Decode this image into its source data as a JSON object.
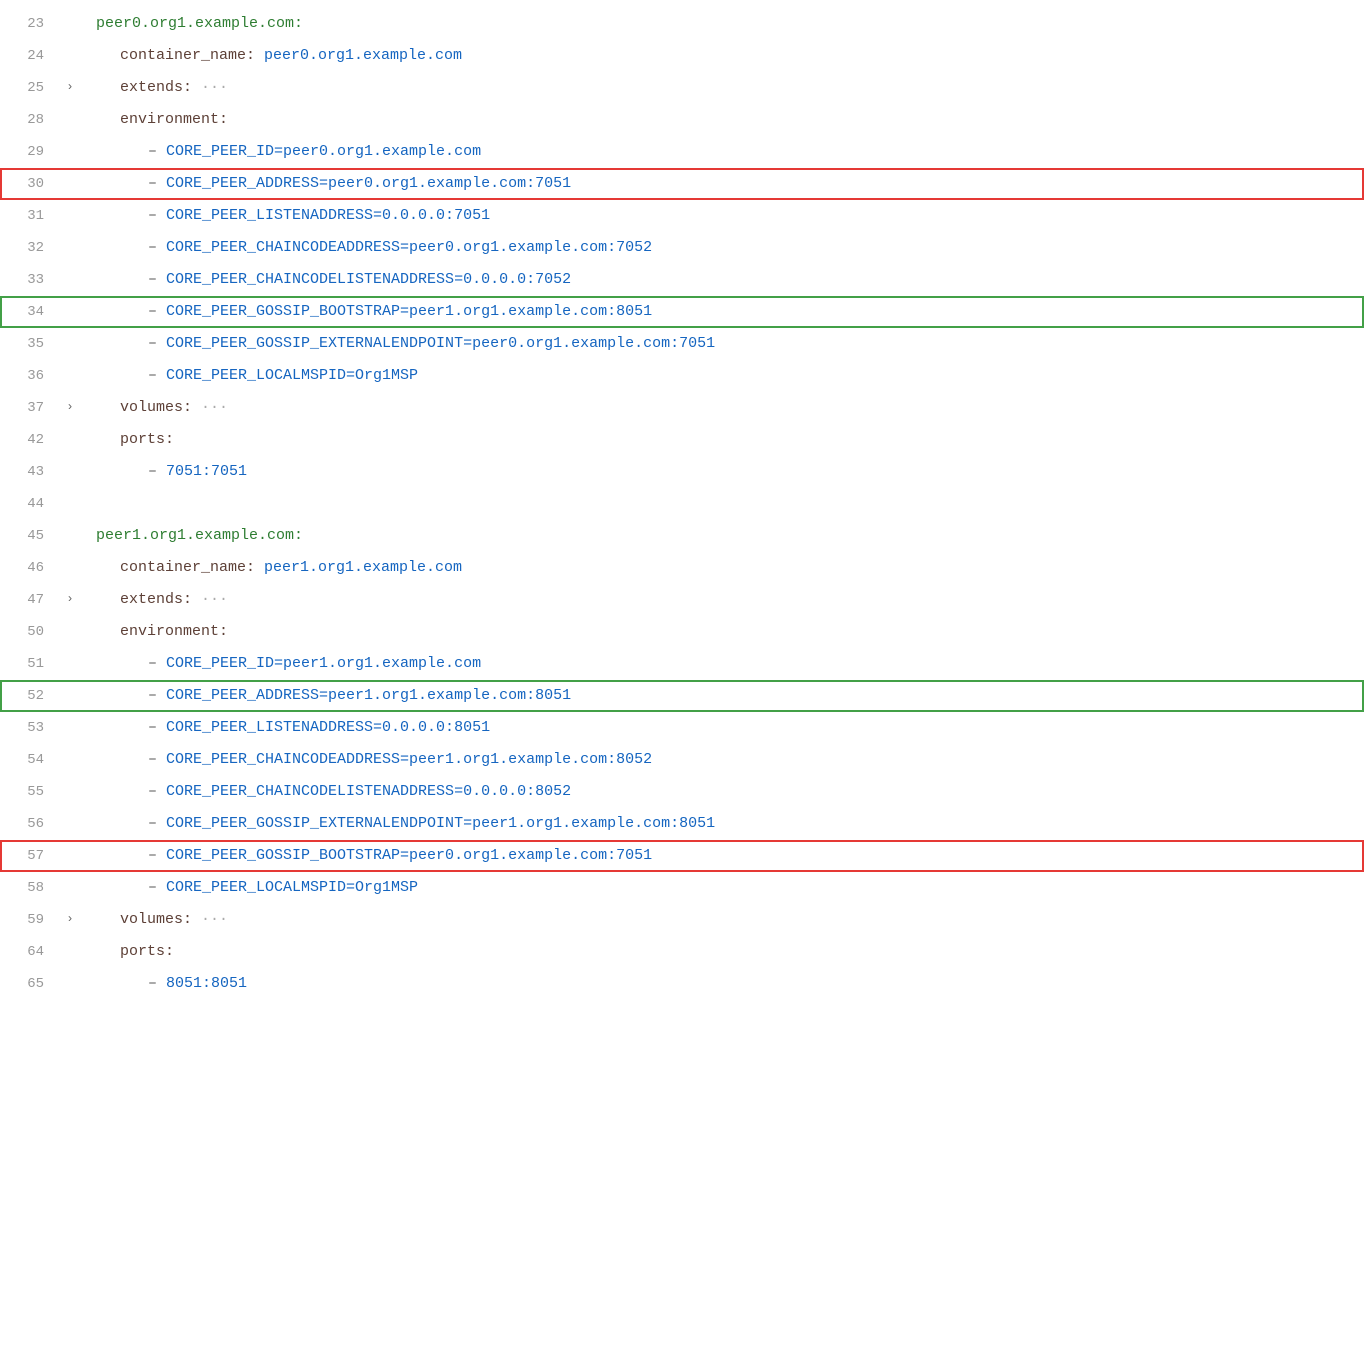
{
  "lines": [
    {
      "num": 23,
      "indent": 1,
      "highlight": null,
      "gutter": null,
      "content": [
        {
          "type": "key-green",
          "text": "peer0.org1.example.com:"
        }
      ]
    },
    {
      "num": 24,
      "indent": 2,
      "highlight": null,
      "gutter": null,
      "content": [
        {
          "type": "key-dark",
          "text": "container_name: "
        },
        {
          "type": "value-blue",
          "text": "peer0.org1.example.com"
        }
      ]
    },
    {
      "num": 25,
      "indent": 2,
      "highlight": null,
      "gutter": "›",
      "content": [
        {
          "type": "key-dark",
          "text": "extends: "
        },
        {
          "type": "ellipsis",
          "text": "···"
        }
      ]
    },
    {
      "num": 28,
      "indent": 2,
      "highlight": null,
      "gutter": null,
      "content": [
        {
          "type": "key-dark",
          "text": "environment:"
        }
      ]
    },
    {
      "num": 29,
      "indent": 3,
      "highlight": null,
      "gutter": null,
      "content": [
        {
          "type": "dash",
          "text": "– "
        },
        {
          "type": "value-blue",
          "text": "CORE_PEER_ID=peer0.org1.example.com"
        }
      ]
    },
    {
      "num": 30,
      "indent": 3,
      "highlight": "red",
      "gutter": null,
      "content": [
        {
          "type": "dash",
          "text": "– "
        },
        {
          "type": "value-blue",
          "text": "CORE_PEER_ADDRESS=peer0.org1.example.com:7051"
        }
      ]
    },
    {
      "num": 31,
      "indent": 3,
      "highlight": null,
      "gutter": null,
      "content": [
        {
          "type": "dash",
          "text": "– "
        },
        {
          "type": "value-blue",
          "text": "CORE_PEER_LISTENADDRESS=0.0.0.0:7051"
        }
      ]
    },
    {
      "num": 32,
      "indent": 3,
      "highlight": null,
      "gutter": null,
      "content": [
        {
          "type": "dash",
          "text": "– "
        },
        {
          "type": "value-blue",
          "text": "CORE_PEER_CHAINCODEADDRESS=peer0.org1.example.com:7052"
        }
      ]
    },
    {
      "num": 33,
      "indent": 3,
      "highlight": null,
      "gutter": null,
      "content": [
        {
          "type": "dash",
          "text": "– "
        },
        {
          "type": "value-blue",
          "text": "CORE_PEER_CHAINCODELISTENADDRESS=0.0.0.0:7052"
        }
      ]
    },
    {
      "num": 34,
      "indent": 3,
      "highlight": "green",
      "gutter": null,
      "content": [
        {
          "type": "dash",
          "text": "– "
        },
        {
          "type": "value-blue",
          "text": "CORE_PEER_GOSSIP_BOOTSTRAP=peer1.org1.example.com:8051"
        }
      ]
    },
    {
      "num": 35,
      "indent": 3,
      "highlight": null,
      "gutter": null,
      "content": [
        {
          "type": "dash",
          "text": "– "
        },
        {
          "type": "value-blue",
          "text": "CORE_PEER_GOSSIP_EXTERNALENDPOINT=peer0.org1.example.com:7051"
        }
      ]
    },
    {
      "num": 36,
      "indent": 3,
      "highlight": null,
      "gutter": null,
      "content": [
        {
          "type": "dash",
          "text": "– "
        },
        {
          "type": "value-blue",
          "text": "CORE_PEER_LOCALMSPID=Org1MSP"
        }
      ]
    },
    {
      "num": 37,
      "indent": 2,
      "highlight": null,
      "gutter": "›",
      "content": [
        {
          "type": "key-dark",
          "text": "volumes: "
        },
        {
          "type": "ellipsis",
          "text": "···"
        }
      ]
    },
    {
      "num": 42,
      "indent": 2,
      "highlight": null,
      "gutter": null,
      "content": [
        {
          "type": "key-dark",
          "text": "ports:"
        }
      ]
    },
    {
      "num": 43,
      "indent": 3,
      "highlight": null,
      "gutter": null,
      "content": [
        {
          "type": "dash",
          "text": "– "
        },
        {
          "type": "value-blue",
          "text": "7051:7051"
        }
      ]
    },
    {
      "num": 44,
      "indent": 0,
      "highlight": null,
      "gutter": null,
      "content": [],
      "empty": true
    },
    {
      "num": 45,
      "indent": 1,
      "highlight": null,
      "gutter": null,
      "content": [
        {
          "type": "key-green",
          "text": "peer1.org1.example.com:"
        }
      ]
    },
    {
      "num": 46,
      "indent": 2,
      "highlight": null,
      "gutter": null,
      "content": [
        {
          "type": "key-dark",
          "text": "container_name: "
        },
        {
          "type": "value-blue",
          "text": "peer1.org1.example.com"
        }
      ]
    },
    {
      "num": 47,
      "indent": 2,
      "highlight": null,
      "gutter": "›",
      "content": [
        {
          "type": "key-dark",
          "text": "extends: "
        },
        {
          "type": "ellipsis",
          "text": "···"
        }
      ]
    },
    {
      "num": 50,
      "indent": 2,
      "highlight": null,
      "gutter": null,
      "content": [
        {
          "type": "key-dark",
          "text": "environment:"
        }
      ]
    },
    {
      "num": 51,
      "indent": 3,
      "highlight": null,
      "gutter": null,
      "content": [
        {
          "type": "dash",
          "text": "– "
        },
        {
          "type": "value-blue",
          "text": "CORE_PEER_ID=peer1.org1.example.com"
        }
      ]
    },
    {
      "num": 52,
      "indent": 3,
      "highlight": "green",
      "gutter": null,
      "content": [
        {
          "type": "dash",
          "text": "– "
        },
        {
          "type": "value-blue",
          "text": "CORE_PEER_ADDRESS=peer1.org1.example.com:8051"
        }
      ]
    },
    {
      "num": 53,
      "indent": 3,
      "highlight": null,
      "gutter": null,
      "content": [
        {
          "type": "dash",
          "text": "– "
        },
        {
          "type": "value-blue",
          "text": "CORE_PEER_LISTENADDRESS=0.0.0.0:8051"
        }
      ]
    },
    {
      "num": 54,
      "indent": 3,
      "highlight": null,
      "gutter": null,
      "content": [
        {
          "type": "dash",
          "text": "– "
        },
        {
          "type": "value-blue",
          "text": "CORE_PEER_CHAINCODEADDRESS=peer1.org1.example.com:8052"
        }
      ]
    },
    {
      "num": 55,
      "indent": 3,
      "highlight": null,
      "gutter": null,
      "content": [
        {
          "type": "dash",
          "text": "– "
        },
        {
          "type": "value-blue",
          "text": "CORE_PEER_CHAINCODELISTENADDRESS=0.0.0.0:8052"
        }
      ]
    },
    {
      "num": 56,
      "indent": 3,
      "highlight": null,
      "gutter": null,
      "content": [
        {
          "type": "dash",
          "text": "– "
        },
        {
          "type": "value-blue",
          "text": "CORE_PEER_GOSSIP_EXTERNALENDPOINT=peer1.org1.example.com:8051"
        }
      ]
    },
    {
      "num": 57,
      "indent": 3,
      "highlight": "red",
      "gutter": null,
      "content": [
        {
          "type": "dash",
          "text": "– "
        },
        {
          "type": "value-blue",
          "text": "CORE_PEER_GOSSIP_BOOTSTRAP=peer0.org1.example.com:7051"
        }
      ]
    },
    {
      "num": 58,
      "indent": 3,
      "highlight": null,
      "gutter": null,
      "content": [
        {
          "type": "dash",
          "text": "– "
        },
        {
          "type": "value-blue",
          "text": "CORE_PEER_LOCALMSPID=Org1MSP"
        }
      ]
    },
    {
      "num": 59,
      "indent": 2,
      "highlight": null,
      "gutter": "›",
      "content": [
        {
          "type": "key-dark",
          "text": "volumes: "
        },
        {
          "type": "ellipsis",
          "text": "···"
        }
      ]
    },
    {
      "num": 64,
      "indent": 2,
      "highlight": null,
      "gutter": null,
      "content": [
        {
          "type": "key-dark",
          "text": "ports:"
        }
      ]
    },
    {
      "num": 65,
      "indent": 3,
      "highlight": null,
      "gutter": null,
      "content": [
        {
          "type": "dash",
          "text": "– "
        },
        {
          "type": "value-blue",
          "text": "8051:8051"
        }
      ]
    }
  ],
  "colors": {
    "key_green": "#2e7d32",
    "key_dark": "#5d4037",
    "value_blue": "#1565c0",
    "highlight_red": "#e53935",
    "highlight_green": "#43a047",
    "line_number": "#999999",
    "background": "#ffffff"
  }
}
